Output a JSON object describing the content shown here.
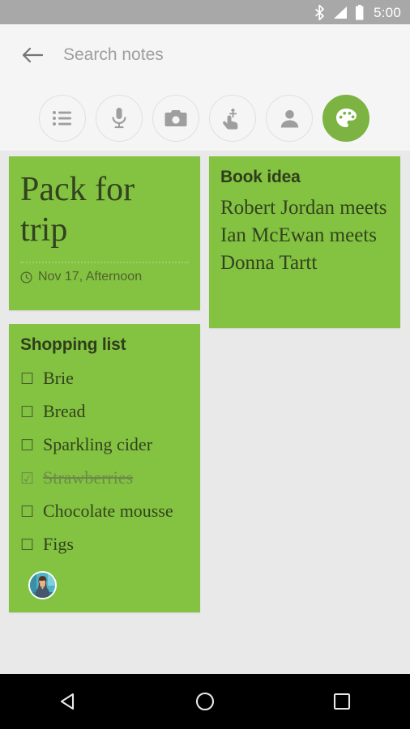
{
  "status_bar": {
    "time": "5:00",
    "icons": [
      "bluetooth-icon",
      "signal-icon",
      "battery-icon"
    ],
    "background": "#a8a8a8"
  },
  "search": {
    "back_label": "back-arrow",
    "placeholder": "Search notes",
    "value": ""
  },
  "chips": [
    {
      "name": "list-chip",
      "icon": "list-icon",
      "active": false
    },
    {
      "name": "audio-chip",
      "icon": "microphone-icon",
      "active": false
    },
    {
      "name": "image-chip",
      "icon": "camera-icon",
      "active": false
    },
    {
      "name": "drawing-chip",
      "icon": "hand-draw-icon",
      "active": false
    },
    {
      "name": "shared-chip",
      "icon": "person-icon",
      "active": false
    },
    {
      "name": "color-chip",
      "icon": "palette-icon",
      "active": true
    }
  ],
  "colors": {
    "note_green": "#83c341",
    "accent_green": "#7cb342",
    "page_background": "#e9e9e9",
    "toolbar_background": "#f5f5f5",
    "note_text": "#33421f"
  },
  "notes": {
    "pack_for_trip": {
      "title": "Pack for trip",
      "reminder": "Nov 17, Afternoon",
      "reminder_icon": "clock-icon"
    },
    "book_idea": {
      "title": "Book idea",
      "body": "Robert Jordan meets Ian McEwan meets Donna Tartt"
    },
    "shopping_list": {
      "title": "Shopping list",
      "items": [
        {
          "text": "Brie",
          "checked": false
        },
        {
          "text": "Bread",
          "checked": false
        },
        {
          "text": "Sparkling cider",
          "checked": false
        },
        {
          "text": "Strawberries",
          "checked": true
        },
        {
          "text": "Chocolate mousse",
          "checked": false
        },
        {
          "text": "Figs",
          "checked": false
        }
      ],
      "more_indicator": "...",
      "collaborator_avatar": "avatar-woman"
    }
  },
  "navigation_bar": {
    "back": "back-triangle",
    "home": "home-circle",
    "recents": "recents-square"
  }
}
